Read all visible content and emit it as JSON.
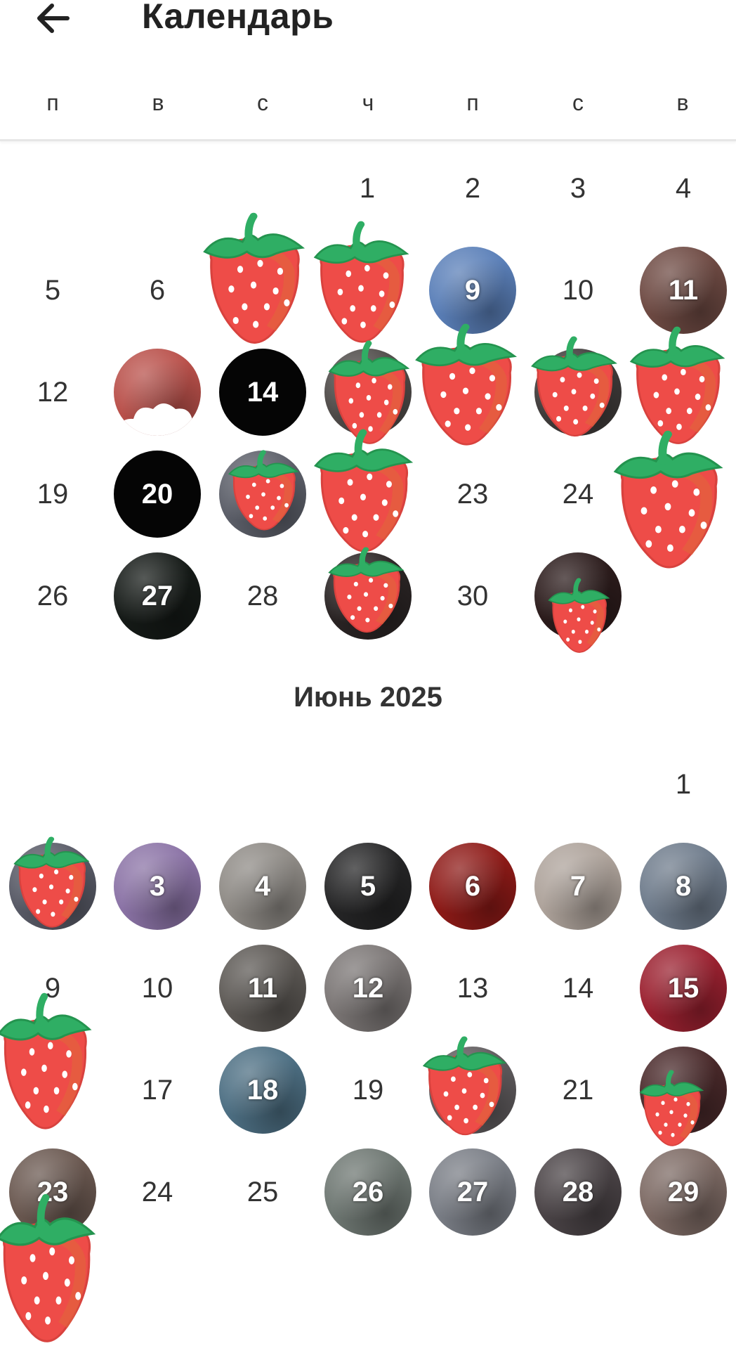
{
  "header": {
    "title": "Календарь",
    "back_icon": "arrow-left-icon"
  },
  "weekdays": [
    "п",
    "в",
    "с",
    "ч",
    "п",
    "с",
    "в"
  ],
  "may": {
    "days": [
      {
        "label": "1",
        "style": "plain"
      },
      {
        "label": "2",
        "style": "plain"
      },
      {
        "label": "3",
        "style": "plain"
      },
      {
        "label": "4",
        "style": "plain"
      },
      {
        "label": "5",
        "style": "plain"
      },
      {
        "label": "6",
        "style": "plain"
      },
      {
        "label": "",
        "style": "plain"
      },
      {
        "label": "",
        "style": "plain"
      },
      {
        "label": "9",
        "style": "photo",
        "color": "#5a7fb8"
      },
      {
        "label": "10",
        "style": "plain"
      },
      {
        "label": "11",
        "style": "photo",
        "color": "#6e4a43"
      },
      {
        "label": "12",
        "style": "plain"
      },
      {
        "label": "",
        "style": "photo",
        "color": "#b9504a"
      },
      {
        "label": "14",
        "style": "black"
      },
      {
        "label": "",
        "style": "photo",
        "color": "#4e4a48"
      },
      {
        "label": "",
        "style": "plain"
      },
      {
        "label": "",
        "style": "photo",
        "color": "#3f3b3a"
      },
      {
        "label": "",
        "style": "plain"
      },
      {
        "label": "19",
        "style": "plain"
      },
      {
        "label": "20",
        "style": "black"
      },
      {
        "label": "",
        "style": "photo",
        "color": "#5c5f69"
      },
      {
        "label": "",
        "style": "plain"
      },
      {
        "label": "23",
        "style": "plain"
      },
      {
        "label": "24",
        "style": "plain"
      },
      {
        "label": "",
        "style": "plain"
      },
      {
        "label": "26",
        "style": "plain"
      },
      {
        "label": "27",
        "style": "photo",
        "color": "#151a17"
      },
      {
        "label": "28",
        "style": "plain"
      },
      {
        "label": "",
        "style": "photo",
        "color": "#2a2424"
      },
      {
        "label": "30",
        "style": "plain"
      },
      {
        "label": "",
        "style": "photo",
        "color": "#2b1b1b"
      }
    ]
  },
  "june": {
    "month_title": "Июнь 2025",
    "days": [
      {
        "label": "1",
        "style": "plain"
      },
      {
        "label": "",
        "style": "photo",
        "color": "#585a66"
      },
      {
        "label": "3",
        "style": "photo",
        "color": "#8b73a6"
      },
      {
        "label": "4",
        "style": "photo",
        "color": "#8f8b86"
      },
      {
        "label": "5",
        "style": "photo",
        "color": "#252526"
      },
      {
        "label": "6",
        "style": "photo",
        "color": "#8e1a17"
      },
      {
        "label": "7",
        "style": "photo",
        "color": "#aea39b"
      },
      {
        "label": "8",
        "style": "photo",
        "color": "#6f7c8c"
      },
      {
        "label": "9",
        "style": "plain"
      },
      {
        "label": "10",
        "style": "plain"
      },
      {
        "label": "11",
        "style": "photo",
        "color": "#5d5955"
      },
      {
        "label": "12",
        "style": "photo",
        "color": "#7b7675"
      },
      {
        "label": "13",
        "style": "plain"
      },
      {
        "label": "14",
        "style": "plain"
      },
      {
        "label": "15",
        "style": "photo",
        "color": "#9b2130"
      },
      {
        "label": "",
        "style": "plain"
      },
      {
        "label": "17",
        "style": "plain"
      },
      {
        "label": "18",
        "style": "photo",
        "color": "#4d6f83"
      },
      {
        "label": "19",
        "style": "plain"
      },
      {
        "label": "",
        "style": "photo",
        "color": "#5f5b5d"
      },
      {
        "label": "21",
        "style": "plain"
      },
      {
        "label": "",
        "style": "photo",
        "color": "#49292a"
      },
      {
        "label": "23",
        "style": "photo",
        "color": "#6a5850"
      },
      {
        "label": "24",
        "style": "plain"
      },
      {
        "label": "25",
        "style": "plain"
      },
      {
        "label": "26",
        "style": "photo",
        "color": "#6e7772"
      },
      {
        "label": "27",
        "style": "photo",
        "color": "#7a7e86"
      },
      {
        "label": "28",
        "style": "photo",
        "color": "#4b4447"
      },
      {
        "label": "29",
        "style": "photo",
        "color": "#7d6a64"
      }
    ]
  },
  "sticker": {
    "icon": "strawberry-icon",
    "color": "#ee4c48",
    "leaf_color": "#2fae64"
  }
}
